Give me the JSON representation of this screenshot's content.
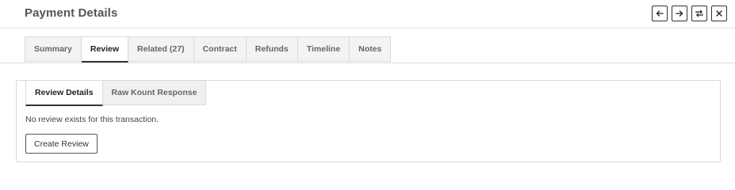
{
  "header": {
    "title": "Payment Details",
    "actions": [
      {
        "name": "arrow-left-icon"
      },
      {
        "name": "arrow-right-icon"
      },
      {
        "name": "refresh-icon"
      },
      {
        "name": "close-icon"
      }
    ]
  },
  "tabs": [
    {
      "label": "Summary",
      "active": false
    },
    {
      "label": "Review",
      "active": true
    },
    {
      "label": "Related (27)",
      "active": false
    },
    {
      "label": "Contract",
      "active": false
    },
    {
      "label": "Refunds",
      "active": false
    },
    {
      "label": "Timeline",
      "active": false
    },
    {
      "label": "Notes",
      "active": false
    }
  ],
  "review": {
    "subtabs": [
      {
        "label": "Review Details",
        "active": true
      },
      {
        "label": "Raw Kount Response",
        "active": false
      }
    ],
    "message": "No review exists for this transaction.",
    "create_button_label": "Create Review"
  }
}
